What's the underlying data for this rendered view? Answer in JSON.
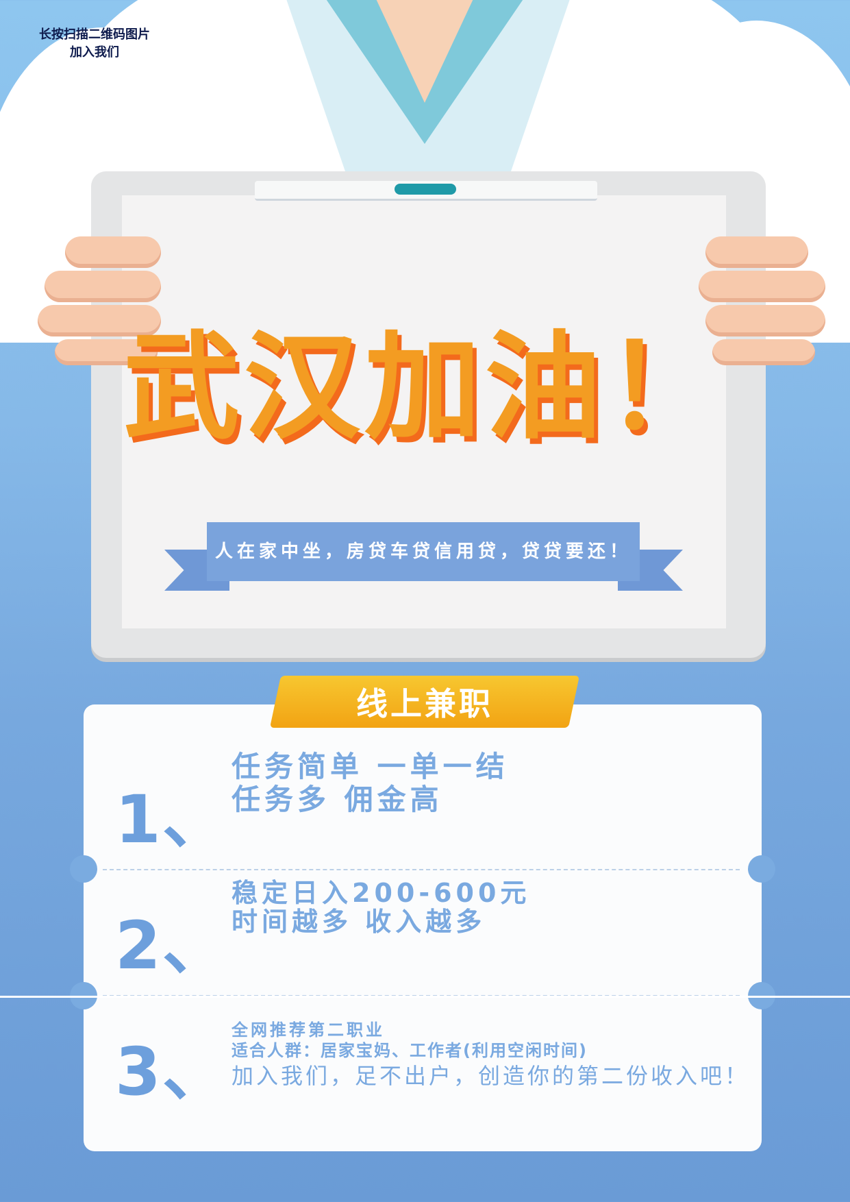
{
  "corner_note": {
    "line1": "长按扫描二维码图片",
    "line2": "加入我们"
  },
  "headline": "武汉加油！",
  "ribbon_text": "人在家中坐，房贷车贷信用贷，贷贷要还！",
  "tag_label": "线上兼职",
  "items": [
    {
      "number": "1、",
      "lines": [
        "任务简单 一单一结",
        "任务多 佣金高"
      ]
    },
    {
      "number": "2、",
      "lines": [
        "稳定日入200-600元",
        "时间越多 收入越多"
      ]
    },
    {
      "number": "3、",
      "lines": [
        "全网推荐第二职业",
        "适合人群：居家宝妈、工作者(利用空闲时间)"
      ],
      "body": "加入我们，足不出户，创造你的第二份收入吧！"
    }
  ],
  "colors": {
    "headline": "#f39c22",
    "headline_shadow": "#f36a1c",
    "accent_blue": "#7aa9e0",
    "tag_yellow": "#f5b51f"
  }
}
